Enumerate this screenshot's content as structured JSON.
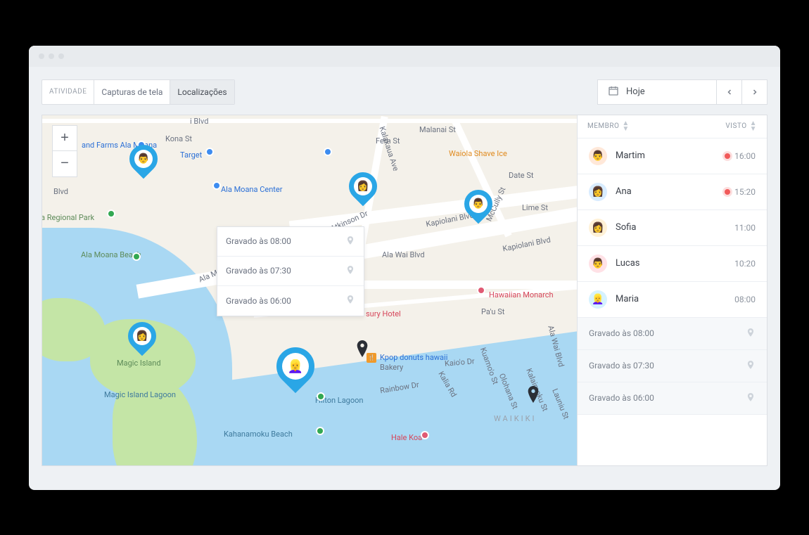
{
  "tabs": {
    "activity": "ATIVIDADE",
    "screenshots": "Capturas de tela",
    "locations": "Localizações"
  },
  "date": {
    "label": "Hoje"
  },
  "zoom": {
    "in": "+",
    "out": "−"
  },
  "side_header": {
    "member": "MEMBRO",
    "seen": "VISTO"
  },
  "members": [
    {
      "name": "Martim",
      "time": "16:00",
      "live": true,
      "avatar_bg": "#ffe8d9",
      "emoji": "👨"
    },
    {
      "name": "Ana",
      "time": "15:20",
      "live": true,
      "avatar_bg": "#d8ecff",
      "emoji": "👩"
    },
    {
      "name": "Sofia",
      "time": "11:00",
      "live": false,
      "avatar_bg": "#fff1d6",
      "emoji": "👩"
    },
    {
      "name": "Lucas",
      "time": "10:20",
      "live": false,
      "avatar_bg": "#ffe1e6",
      "emoji": "👨"
    },
    {
      "name": "Maria",
      "time": "08:00",
      "live": false,
      "avatar_bg": "#d6f2ff",
      "emoji": "👱‍♀️"
    }
  ],
  "records": [
    {
      "label": "Gravado às 08:00"
    },
    {
      "label": "Gravado às 07:30"
    },
    {
      "label": "Gravado às 06:00"
    }
  ],
  "map_labels": {
    "farms": "and Farms Ala Moana",
    "target": "Target",
    "ala_moana_center": "Ala Moana Center",
    "regional_park": "a Regional Park",
    "ala_moana_beach": "Ala Moana Beach",
    "magic_island": "Magic Island",
    "magic_island_lagoon": "Magic Island Lagoon",
    "hilton_lagoon": "Hilton Lagoon",
    "kahanamoku_beach": "Kahanamoku Beach",
    "kpop": "Kpop donuts hawaii",
    "bakery": "Bakery",
    "hale_koa": "Hale Koa",
    "hawaiian_monarch": "Hawaiian Monarch",
    "sury_hotel": "sury Hotel",
    "waiola": "Waiola Shave Ice",
    "waikiki": "WAIKIKI",
    "kapiolani": "Kapiolani Blvd",
    "kalakaua": "Kalakaua Ave",
    "ala_wai": "Ala Wai Blvd",
    "kona": "Kona St",
    "atkinson": "Atkinson Dr",
    "blvd_top": "i Blvd",
    "blvd_left": "Blvd",
    "mccully": "McCully St",
    "fern": "Fern St",
    "malanai": "Malanai St",
    "date": "Date St",
    "lime": "Lime St",
    "pau": "Pa'u St",
    "rainbow": "Rainbow Dr",
    "kalia": "Kalia Rd",
    "ala_moana_blvd": "Ala Moana Blvd",
    "kapiolani2": "Kapiolani Blvd",
    "kaiolu": "Kaio'o Dr",
    "kuamoo": "Kuamo'o St",
    "olohana": "Olohana St",
    "launiu": "Launiu St",
    "kalaimoku": "Kalaimoku St",
    "ala_wai2": "Ala Wai Blvd"
  }
}
